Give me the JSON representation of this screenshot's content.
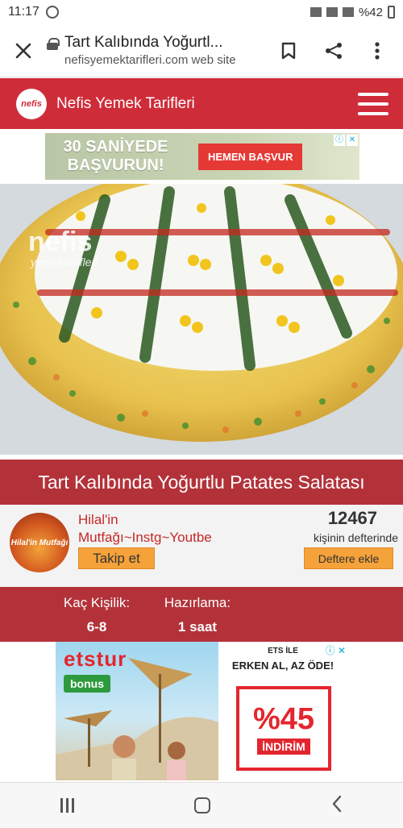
{
  "status": {
    "time": "11:17",
    "battery": "%42"
  },
  "browser": {
    "page_title": "Tart Kalıbında Yoğurtl...",
    "page_url": "nefisyemektarifleri.com web site"
  },
  "site": {
    "name": "Nefis Yemek Tarifleri",
    "logo_text": "nefis"
  },
  "ad_top": {
    "headline": "30 SANİYEDE BAŞVURUN!",
    "button": "HEMEN BAŞVUR"
  },
  "hero": {
    "watermark_brand": "nefis",
    "watermark_sub": "yemektarifleri"
  },
  "recipe": {
    "title": "Tart Kalıbında Yoğurtlu Patates Salatası",
    "author_name": "Hilal'in Mutfağı~Instg~Youtbe",
    "avatar_text": "Hilal'in Mutfağı",
    "follow_label": "Takip et",
    "saved_count": "12467",
    "saved_label": "kişinin defterinde",
    "add_label": "Deftere ekle",
    "servings_label": "Kaç Kişilik:",
    "servings_value": "6-8",
    "prep_label": "Hazırlama:",
    "prep_value": "1 saat"
  },
  "ad_bottom": {
    "brand": "etstur",
    "bonus": "bonus",
    "tagline_small": "ETS İLE",
    "tagline": "ERKEN AL, AZ ÖDE!",
    "percent": "%45",
    "discount": "İNDİRİM"
  },
  "colors": {
    "brand_red": "#cf2c39",
    "title_red": "#b3323a",
    "button_orange": "#f5a23a"
  }
}
